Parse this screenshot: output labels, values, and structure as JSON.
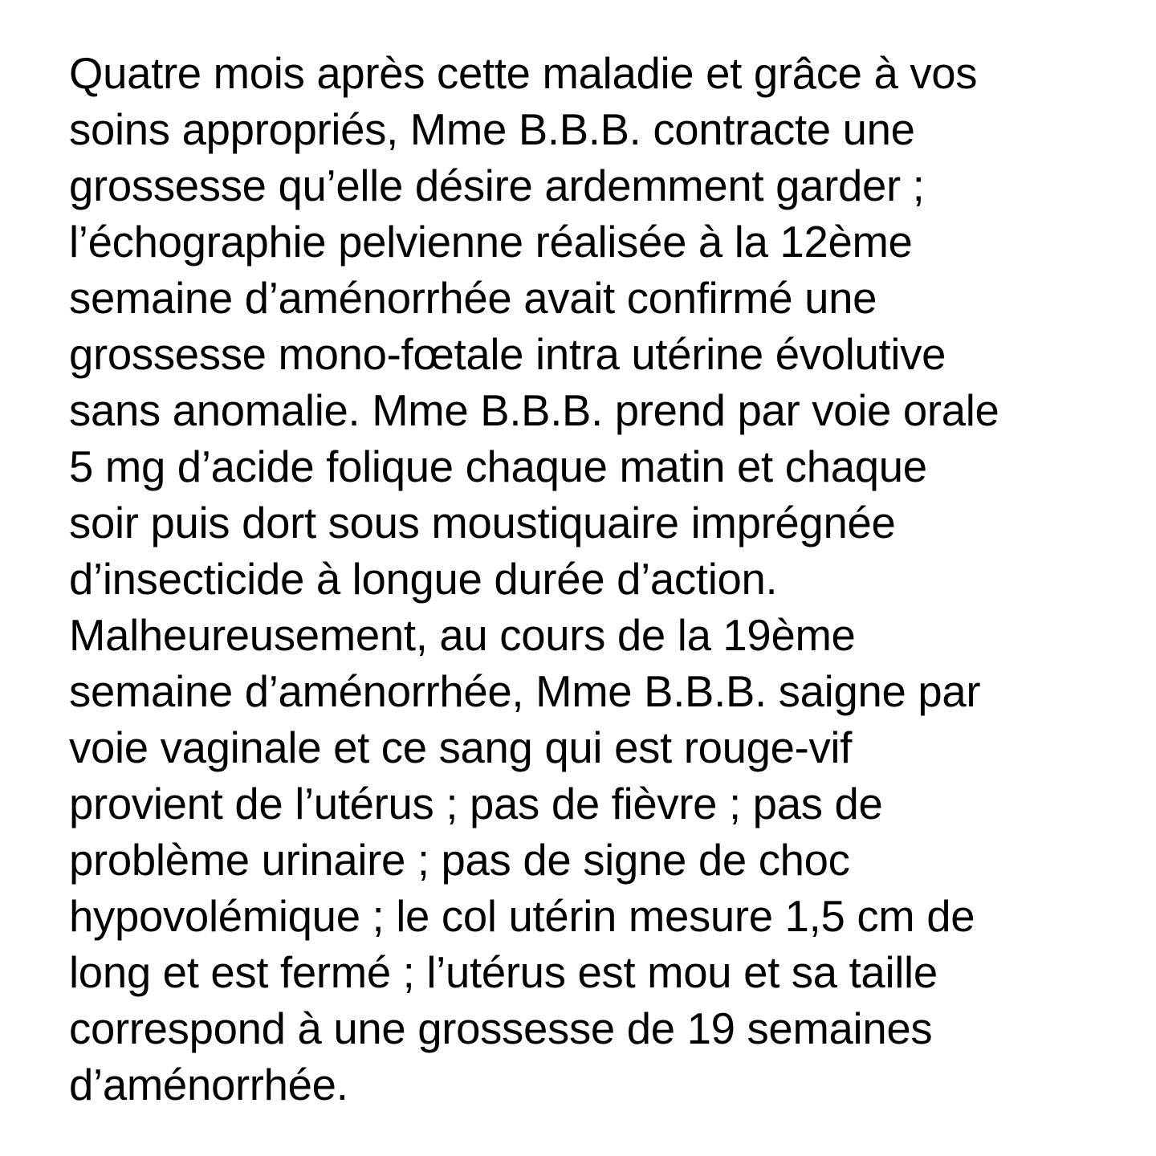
{
  "document": {
    "lines": [
      "Quatre mois après cette maladie et grâce à vos",
      "soins appropriés, Mme B.B.B. contracte une",
      "grossesse qu’elle désire ardemment garder ;",
      "l’échographie pelvienne réalisée à la 12ème",
      "semaine d’aménorrhée avait confirmé une",
      "grossesse mono-fœtale intra utérine évolutive",
      "sans anomalie. Mme B.B.B. prend par voie orale",
      "5 mg d’acide folique chaque matin et chaque",
      "soir puis dort sous moustiquaire imprégnée",
      "d’insecticide à longue durée d’action.",
      "Malheureusement, au cours de la 19ème",
      "semaine d’aménorrhée, Mme B.B.B. saigne par",
      "voie vaginale et ce sang qui est rouge-vif",
      "provient de l’utérus ; pas de fièvre ; pas de",
      "problème urinaire ; pas de signe de choc",
      "hypovolémique ; le col utérin mesure 1,5 cm de",
      "long et est fermé ; l’utérus est mou et sa taille",
      "correspond à une grossesse de 19 semaines",
      "d’aménorrhée."
    ]
  }
}
